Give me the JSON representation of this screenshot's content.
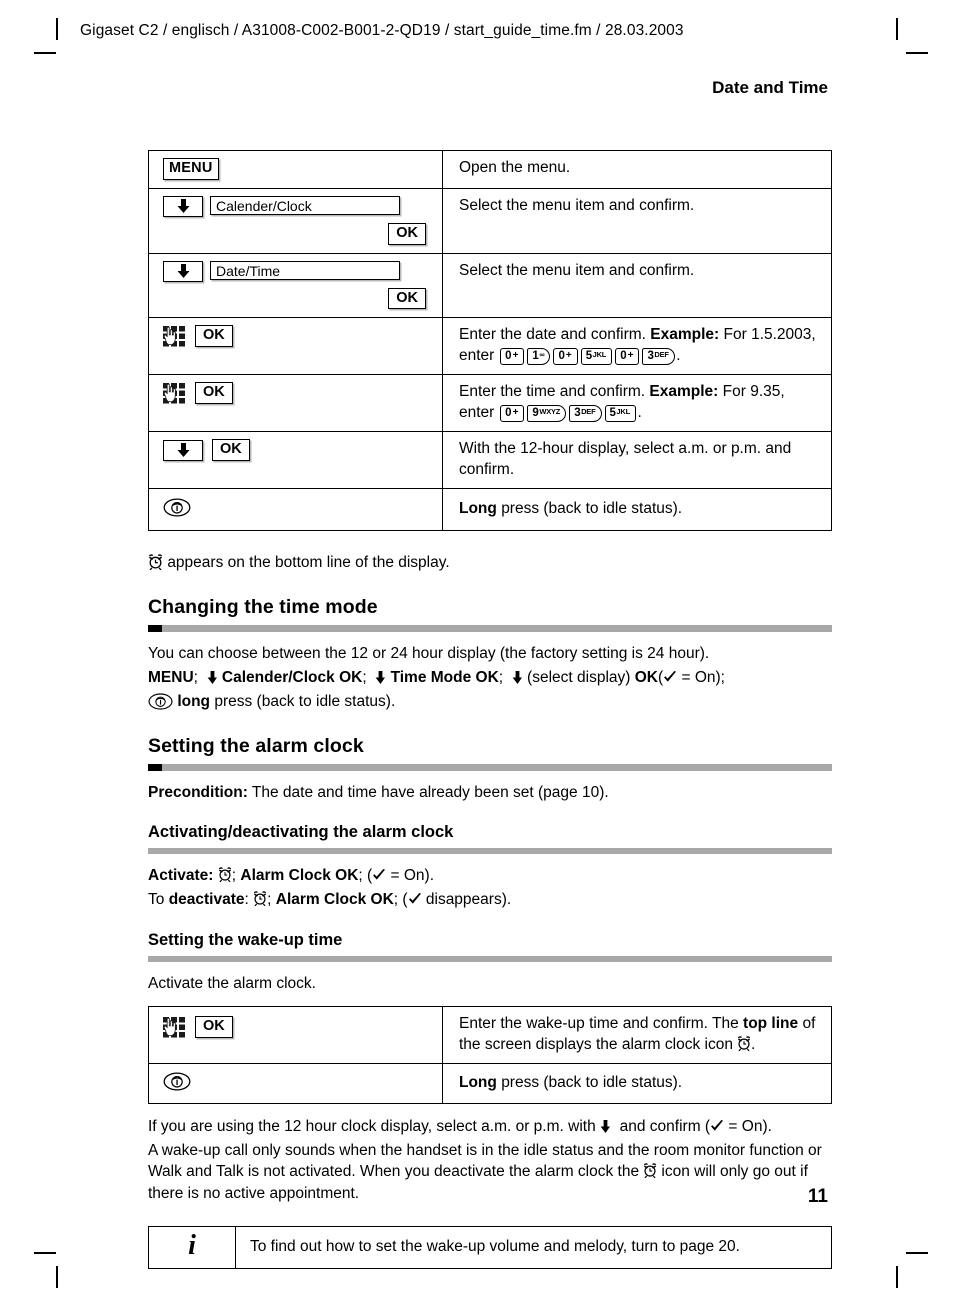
{
  "running_header": "Gigaset C2 / englisch / A31008-C002-B001-2-QD19 / start_guide_time.fm / 28.03.2003",
  "page_header": "Date and Time",
  "page_number": "11",
  "date_time_table": {
    "rows": [
      {
        "key_type": "menu",
        "menu_label": "MENU",
        "description": "Open the menu."
      },
      {
        "key_type": "select",
        "item_label": "Calender/Clock",
        "ok_label": "OK",
        "description": "Select the menu item and confirm."
      },
      {
        "key_type": "select",
        "item_label": "Date/Time",
        "ok_label": "OK",
        "description": "Select the menu item and confirm."
      },
      {
        "key_type": "keypad",
        "ok_label": "OK",
        "desc_lead": "Enter the date and confirm.",
        "desc_bold": "Example:",
        "desc_tail": "For 1.5.2003,",
        "desc_line2_lead": "enter",
        "keys": [
          {
            "digit": "0",
            "letters": "+",
            "shape": "rect"
          },
          {
            "digit": "1",
            "letters": "∞",
            "shape": "rounded"
          },
          {
            "digit": "0",
            "letters": "+",
            "shape": "rect"
          },
          {
            "digit": "5",
            "letters": "JKL",
            "shape": "rect"
          },
          {
            "digit": "0",
            "letters": "+",
            "shape": "rect"
          },
          {
            "digit": "3",
            "letters": "DEF",
            "shape": "rounded"
          }
        ],
        "desc_end": "."
      },
      {
        "key_type": "keypad",
        "ok_label": "OK",
        "desc_lead": "Enter the time and confirm.",
        "desc_bold": "Example:",
        "desc_tail": "For 9.35,",
        "desc_line2_lead": "enter",
        "keys": [
          {
            "digit": "0",
            "letters": "+",
            "shape": "rect"
          },
          {
            "digit": "9",
            "letters": "WXYZ",
            "shape": "rounded"
          },
          {
            "digit": "3",
            "letters": "DEF",
            "shape": "rounded"
          },
          {
            "digit": "5",
            "letters": "JKL",
            "shape": "rect"
          }
        ],
        "desc_end": "."
      },
      {
        "key_type": "arrow_ok",
        "ok_label": "OK",
        "description": "With the 12-hour display, select a.m. or p.m. and confirm."
      },
      {
        "key_type": "endcall",
        "desc_bold": "Long",
        "desc_tail": "press (back to idle status)."
      }
    ]
  },
  "note_after_table": "appears on the bottom line of the display.",
  "section_time_mode": {
    "heading": "Changing the time mode",
    "paragraph": "You can choose between the 12 or 24 hour display (the factory setting is 24 hour).",
    "steps_line1": {
      "menu": "MENU",
      "sep1": ";",
      "item1": "Calender/Clock",
      "ok1": "OK",
      "sep2": ";",
      "item2": "Time Mode",
      "ok2": "OK",
      "sep3": ";",
      "select_display": "(select display)",
      "ok3": "OK",
      "paren_open": "(",
      "equals_on": "= On);"
    },
    "steps_line2": {
      "bold": "long",
      "tail": "press (back to idle status)."
    }
  },
  "section_alarm": {
    "heading": "Setting the alarm clock",
    "precondition_bold": "Precondition:",
    "precondition_text": "The date and time have already been set (page 10).",
    "sub_heading": "Activating/deactivating the alarm clock",
    "activate_label": "Activate:",
    "activate_sep": ";",
    "activate_menu": "Alarm Clock OK",
    "activate_tail": "= On).",
    "deactivate_lead": "To",
    "deactivate_bold": "deactivate",
    "deactivate_sep": ":",
    "deactivate_semi": ";",
    "deactivate_menu": "Alarm Clock OK",
    "deactivate_tail": "disappears)."
  },
  "section_wakeup": {
    "heading": "Setting the wake-up time",
    "intro": "Activate the alarm clock.",
    "table": {
      "rows": [
        {
          "key_type": "keypad",
          "ok_label": "OK",
          "desc_lead": "Enter the wake-up time and confirm. The",
          "desc_bold": "top line",
          "desc_tail": "of the screen displays the alarm clock icon",
          "desc_end": "."
        },
        {
          "key_type": "endcall",
          "desc_bold": "Long",
          "desc_tail": "press (back to idle status)."
        }
      ]
    },
    "para_12h_lead": "If you are using the 12 hour clock display, select a.m. or p.m. with",
    "para_12h_mid": "and confirm (",
    "para_12h_tail": "= On).",
    "para_wakeup_part1": "A wake-up call only sounds when the handset is in the idle status and the room monitor function or Walk and Talk is not activated. When you deactivate the alarm clock the",
    "para_wakeup_part2": "icon will only go out if there is no active appointment."
  },
  "info_box": {
    "icon": "i",
    "text": "To find out how to set the wake-up volume and melody, turn to page 20."
  },
  "colors": {
    "rule_gray": "#a8a8a8",
    "rule_black": "#000000",
    "shadow_gray": "#b9b9b9"
  }
}
